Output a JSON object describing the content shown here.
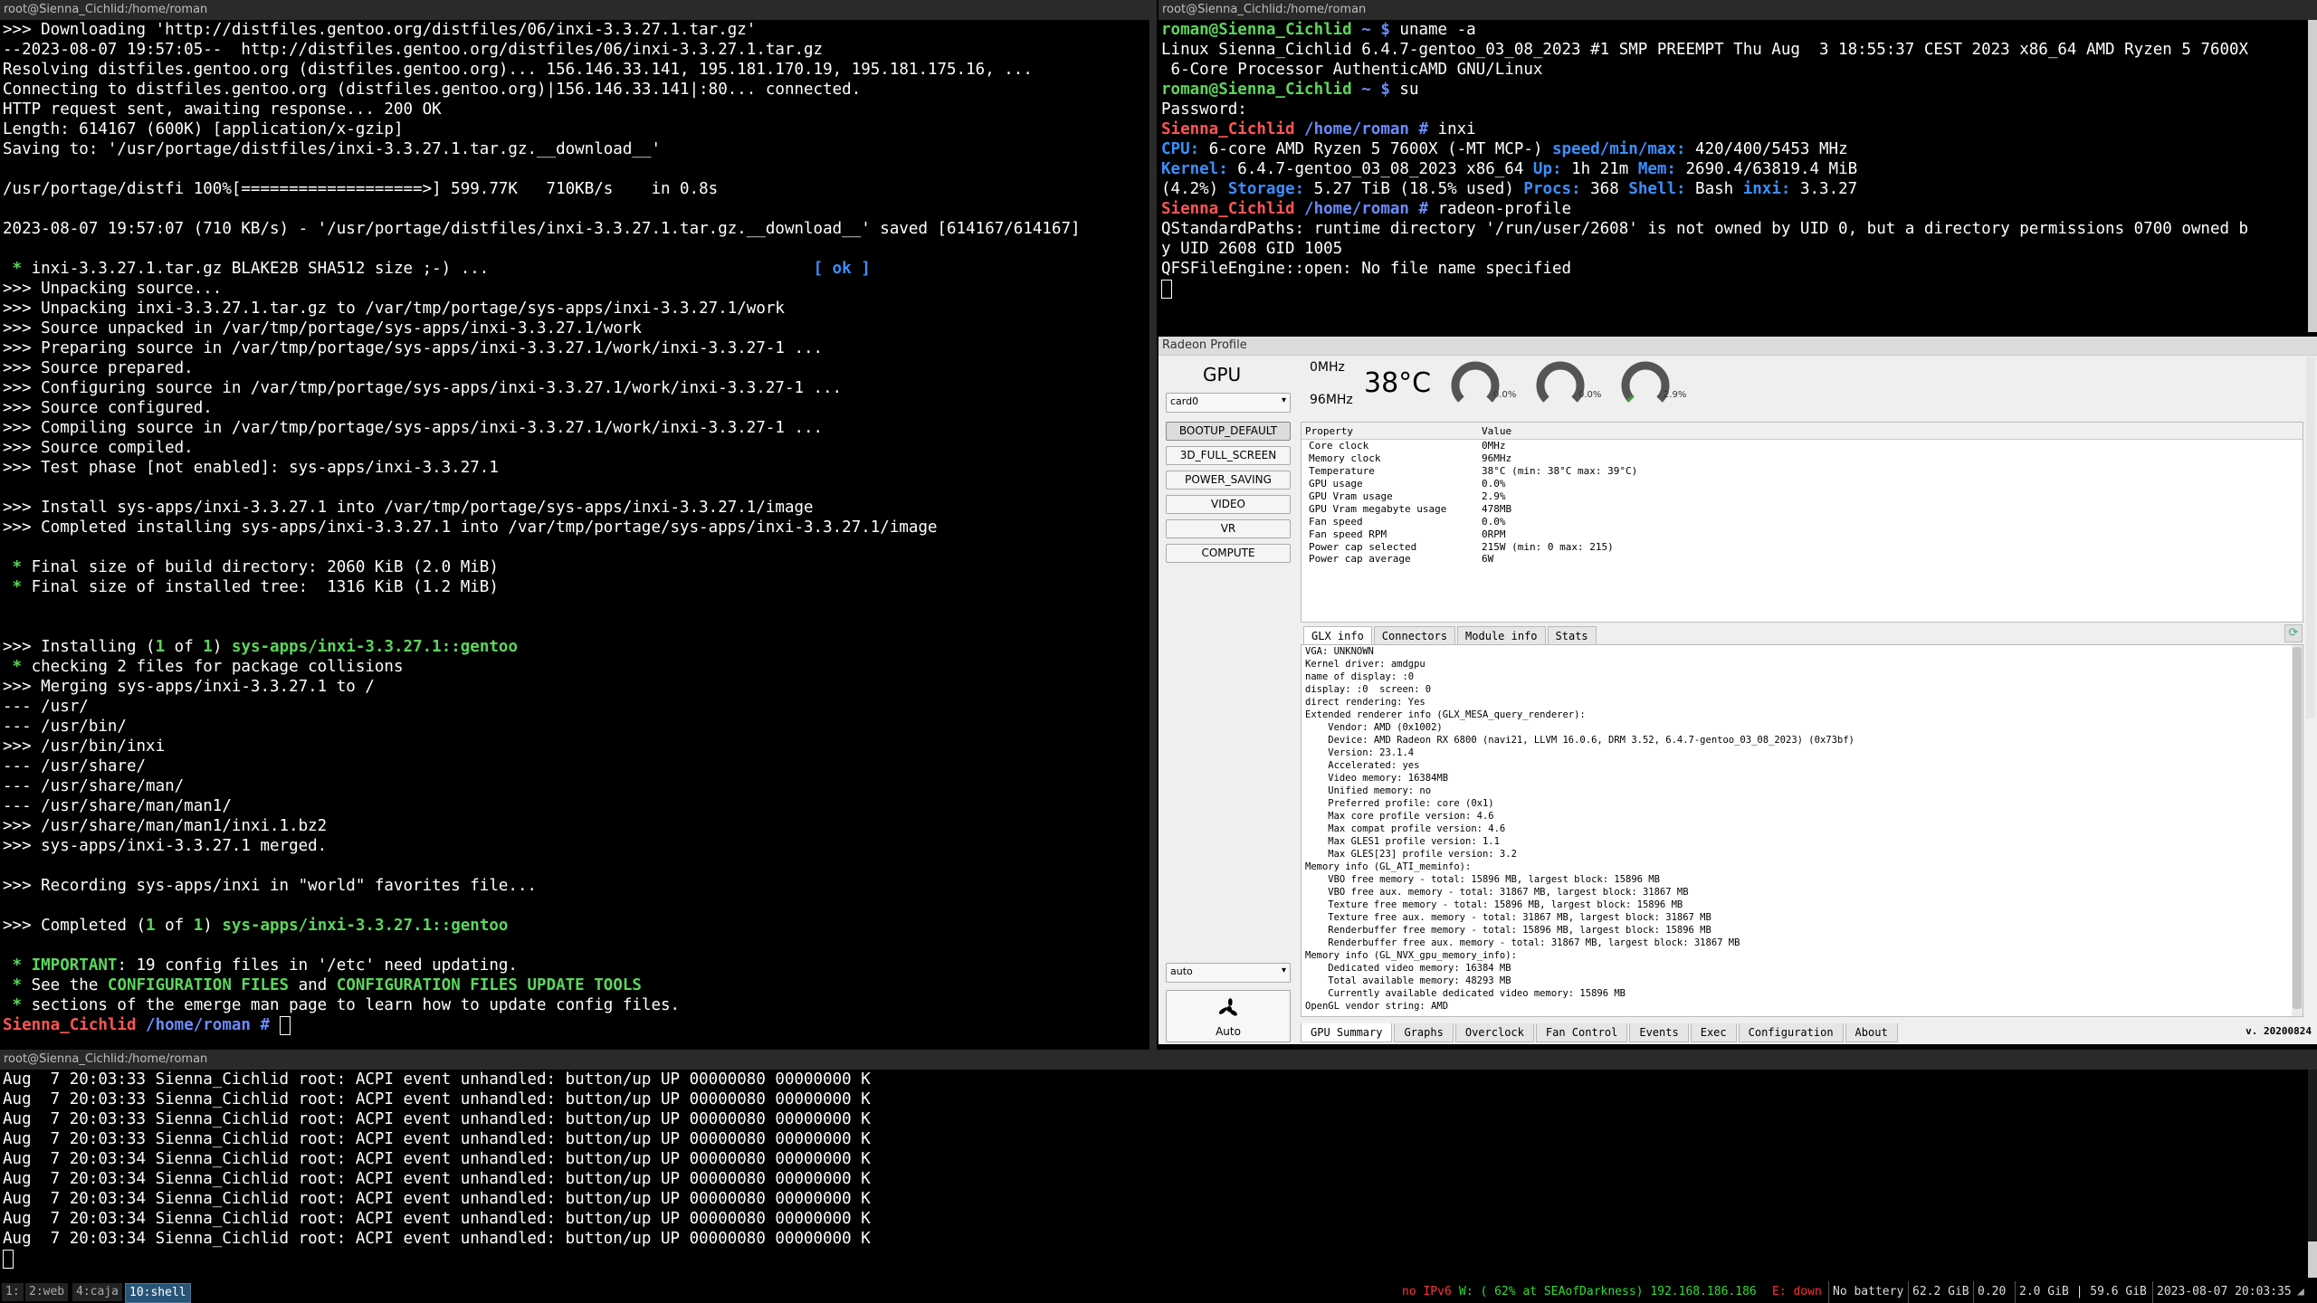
{
  "left_term": {
    "title": "root@Sienna_Cichlid:/home/roman",
    "lines": [
      [
        {
          "t": ">>> Downloading 'http://distfiles.gentoo.org/distfiles/06/inxi-3.3.27.1.tar.gz'"
        }
      ],
      [
        {
          "t": "--2023-08-07 19:57:05--  http://distfiles.gentoo.org/distfiles/06/inxi-3.3.27.1.tar.gz"
        }
      ],
      [
        {
          "t": "Resolving distfiles.gentoo.org (distfiles.gentoo.org)... 156.146.33.141, 195.181.170.19, 195.181.175.16, ..."
        }
      ],
      [
        {
          "t": "Connecting to distfiles.gentoo.org (distfiles.gentoo.org)|156.146.33.141|:80... connected."
        }
      ],
      [
        {
          "t": "HTTP request sent, awaiting response... 200 OK"
        }
      ],
      [
        {
          "t": "Length: 614167 (600K) [application/x-gzip]"
        }
      ],
      [
        {
          "t": "Saving to: '/usr/portage/distfiles/inxi-3.3.27.1.tar.gz.__download__'"
        }
      ],
      [
        {
          "t": ""
        }
      ],
      [
        {
          "t": "/usr/portage/distfi 100%[===================>] 599.77K   710KB/s    in 0.8s"
        }
      ],
      [
        {
          "t": ""
        }
      ],
      [
        {
          "t": "2023-08-07 19:57:07 (710 KB/s) - '/usr/portage/distfiles/inxi-3.3.27.1.tar.gz.__download__' saved [614167/614167]"
        }
      ],
      [
        {
          "t": ""
        }
      ],
      [
        {
          "t": " * ",
          "c": "c-green"
        },
        {
          "t": "inxi-3.3.27.1.tar.gz BLAKE2B SHA512 size ;-) ...                                  "
        },
        {
          "t": "[ ok ]",
          "c": "ok"
        }
      ],
      [
        {
          "t": ">>> Unpacking source..."
        }
      ],
      [
        {
          "t": ">>> Unpacking inxi-3.3.27.1.tar.gz to /var/tmp/portage/sys-apps/inxi-3.3.27.1/work"
        }
      ],
      [
        {
          "t": ">>> Source unpacked in /var/tmp/portage/sys-apps/inxi-3.3.27.1/work"
        }
      ],
      [
        {
          "t": ">>> Preparing source in /var/tmp/portage/sys-apps/inxi-3.3.27.1/work/inxi-3.3.27-1 ..."
        }
      ],
      [
        {
          "t": ">>> Source prepared."
        }
      ],
      [
        {
          "t": ">>> Configuring source in /var/tmp/portage/sys-apps/inxi-3.3.27.1/work/inxi-3.3.27-1 ..."
        }
      ],
      [
        {
          "t": ">>> Source configured."
        }
      ],
      [
        {
          "t": ">>> Compiling source in /var/tmp/portage/sys-apps/inxi-3.3.27.1/work/inxi-3.3.27-1 ..."
        }
      ],
      [
        {
          "t": ">>> Source compiled."
        }
      ],
      [
        {
          "t": ">>> Test phase [not enabled]: sys-apps/inxi-3.3.27.1"
        }
      ],
      [
        {
          "t": ""
        }
      ],
      [
        {
          "t": ">>> Install sys-apps/inxi-3.3.27.1 into /var/tmp/portage/sys-apps/inxi-3.3.27.1/image"
        }
      ],
      [
        {
          "t": ">>> Completed installing sys-apps/inxi-3.3.27.1 into /var/tmp/portage/sys-apps/inxi-3.3.27.1/image"
        }
      ],
      [
        {
          "t": ""
        }
      ],
      [
        {
          "t": " * ",
          "c": "c-green"
        },
        {
          "t": "Final size of build directory: 2060 KiB (2.0 MiB)"
        }
      ],
      [
        {
          "t": " * ",
          "c": "c-green"
        },
        {
          "t": "Final size of installed tree:  1316 KiB (1.2 MiB)"
        }
      ],
      [
        {
          "t": ""
        }
      ],
      [
        {
          "t": ""
        }
      ],
      [
        {
          "t": ">>> Installing ("
        },
        {
          "t": "1",
          "c": "c-green"
        },
        {
          "t": " of "
        },
        {
          "t": "1",
          "c": "c-green"
        },
        {
          "t": ") "
        },
        {
          "t": "sys-apps/inxi-3.3.27.1::gentoo",
          "c": "c-green"
        }
      ],
      [
        {
          "t": " * ",
          "c": "c-green"
        },
        {
          "t": "checking 2 files for package collisions"
        }
      ],
      [
        {
          "t": ">>> Merging sys-apps/inxi-3.3.27.1 to /"
        }
      ],
      [
        {
          "t": "--- /usr/"
        }
      ],
      [
        {
          "t": "--- /usr/bin/"
        }
      ],
      [
        {
          "t": ">>> /usr/bin/inxi"
        }
      ],
      [
        {
          "t": "--- /usr/share/"
        }
      ],
      [
        {
          "t": "--- /usr/share/man/"
        }
      ],
      [
        {
          "t": "--- /usr/share/man/man1/"
        }
      ],
      [
        {
          "t": ">>> /usr/share/man/man1/inxi.1.bz2"
        }
      ],
      [
        {
          "t": ">>> sys-apps/inxi-3.3.27.1 merged."
        }
      ],
      [
        {
          "t": ""
        }
      ],
      [
        {
          "t": ">>> Recording sys-apps/inxi in \"world\" favorites file..."
        }
      ],
      [
        {
          "t": ""
        }
      ],
      [
        {
          "t": ">>> Completed ("
        },
        {
          "t": "1",
          "c": "c-green"
        },
        {
          "t": " of "
        },
        {
          "t": "1",
          "c": "c-green"
        },
        {
          "t": ") "
        },
        {
          "t": "sys-apps/inxi-3.3.27.1::gentoo",
          "c": "c-green"
        }
      ],
      [
        {
          "t": ""
        }
      ],
      [
        {
          "t": " * ",
          "c": "c-green"
        },
        {
          "t": "IMPORTANT",
          "c": "c-green"
        },
        {
          "t": ": 19 config files in '/etc' need updating."
        }
      ],
      [
        {
          "t": " * ",
          "c": "c-green"
        },
        {
          "t": "See the "
        },
        {
          "t": "CONFIGURATION FILES",
          "c": "c-green"
        },
        {
          "t": " and "
        },
        {
          "t": "CONFIGURATION FILES UPDATE TOOLS",
          "c": "c-green"
        }
      ],
      [
        {
          "t": " * ",
          "c": "c-green"
        },
        {
          "t": "sections of the emerge man page to learn how to update config files."
        }
      ],
      [
        {
          "t": "Sienna_Cichlid",
          "c": "c-red"
        },
        {
          "t": " /home/roman #",
          "c": "c-blue"
        },
        {
          "t": " "
        }
      ]
    ]
  },
  "right_term": {
    "title": "root@Sienna_Cichlid:/home/roman",
    "lines": [
      [
        {
          "t": "roman@Sienna_Cichlid",
          "c": "c-green"
        },
        {
          "t": " ~ $ ",
          "c": "c-blue"
        },
        {
          "t": "uname -a"
        }
      ],
      [
        {
          "t": "Linux Sienna_Cichlid 6.4.7-gentoo_03_08_2023 #1 SMP PREEMPT Thu Aug  3 18:55:37 CEST 2023 x86_64 AMD Ryzen 5 7600X"
        }
      ],
      [
        {
          "t": " 6-Core Processor AuthenticAMD GNU/Linux"
        }
      ],
      [
        {
          "t": "roman@Sienna_Cichlid",
          "c": "c-green"
        },
        {
          "t": " ~ $ ",
          "c": "c-blue"
        },
        {
          "t": "su"
        }
      ],
      [
        {
          "t": "Password:"
        }
      ],
      [
        {
          "t": "Sienna_Cichlid",
          "c": "c-red"
        },
        {
          "t": " /home/roman # ",
          "c": "c-blue"
        },
        {
          "t": "inxi"
        }
      ],
      [
        {
          "t": "CPU:",
          "c": "c-cyan"
        },
        {
          "t": " 6-core AMD Ryzen 5 7600X (-MT MCP-) "
        },
        {
          "t": "speed/min/max:",
          "c": "c-cyan"
        },
        {
          "t": " 420/400/5453 MHz"
        }
      ],
      [
        {
          "t": "Kernel:",
          "c": "c-cyan"
        },
        {
          "t": " 6.4.7-gentoo_03_08_2023 x86_64 "
        },
        {
          "t": "Up:",
          "c": "c-cyan"
        },
        {
          "t": " 1h 21m "
        },
        {
          "t": "Mem:",
          "c": "c-cyan"
        },
        {
          "t": " 2690.4/63819.4 MiB"
        }
      ],
      [
        {
          "t": "(4.2%) "
        },
        {
          "t": "Storage:",
          "c": "c-cyan"
        },
        {
          "t": " 5.27 TiB (18.5% used) "
        },
        {
          "t": "Procs:",
          "c": "c-cyan"
        },
        {
          "t": " 368 "
        },
        {
          "t": "Shell:",
          "c": "c-cyan"
        },
        {
          "t": " Bash "
        },
        {
          "t": "inxi:",
          "c": "c-cyan"
        },
        {
          "t": " 3.3.27"
        }
      ],
      [
        {
          "t": "Sienna_Cichlid",
          "c": "c-red"
        },
        {
          "t": " /home/roman # ",
          "c": "c-blue"
        },
        {
          "t": "radeon-profile"
        }
      ],
      [
        {
          "t": "QStandardPaths: runtime directory '/run/user/2608' is not owned by UID 0, but a directory permissions 0700 owned b"
        }
      ],
      [
        {
          "t": "y UID 2608 GID 1005"
        }
      ],
      [
        {
          "t": "QFSFileEngine::open: No file name specified"
        }
      ]
    ]
  },
  "bottom_term": {
    "title": "root@Sienna_Cichlid:/home/roman",
    "lines": [
      "Aug  7 20:03:33 Sienna_Cichlid root: ACPI event unhandled: button/up UP 00000080 00000000 K",
      "Aug  7 20:03:33 Sienna_Cichlid root: ACPI event unhandled: button/up UP 00000080 00000000 K",
      "Aug  7 20:03:33 Sienna_Cichlid root: ACPI event unhandled: button/up UP 00000080 00000000 K",
      "Aug  7 20:03:33 Sienna_Cichlid root: ACPI event unhandled: button/up UP 00000080 00000000 K",
      "Aug  7 20:03:34 Sienna_Cichlid root: ACPI event unhandled: button/up UP 00000080 00000000 K",
      "Aug  7 20:03:34 Sienna_Cichlid root: ACPI event unhandled: button/up UP 00000080 00000000 K",
      "Aug  7 20:03:34 Sienna_Cichlid root: ACPI event unhandled: button/up UP 00000080 00000000 K",
      "Aug  7 20:03:34 Sienna_Cichlid root: ACPI event unhandled: button/up UP 00000080 00000000 K",
      "Aug  7 20:03:34 Sienna_Cichlid root: ACPI event unhandled: button/up UP 00000080 00000000 K"
    ]
  },
  "radeon": {
    "title": "Radeon Profile",
    "gpu_label": "GPU",
    "card_select": "card0",
    "core_mhz": "0MHz",
    "mem_mhz": "96MHz",
    "temp": "38°C",
    "gauges": [
      {
        "pct": "0.0%",
        "value": 0.0
      },
      {
        "pct": "0.0%",
        "value": 0.0
      },
      {
        "pct": "2.9%",
        "value": 0.029
      }
    ],
    "profiles": [
      "BOOTUP_DEFAULT",
      "3D_FULL_SCREEN",
      "POWER_SAVING",
      "VIDEO",
      "VR",
      "COMPUTE"
    ],
    "fan_mode_select": "auto",
    "fan_label": "Auto",
    "props_header": [
      "Property",
      "Value"
    ],
    "props": [
      [
        "Core clock",
        "0MHz"
      ],
      [
        "Memory clock",
        "96MHz"
      ],
      [
        "Temperature",
        "38°C (min: 38°C max: 39°C)"
      ],
      [
        "GPU usage",
        "0.0%"
      ],
      [
        "GPU Vram usage",
        "2.9%"
      ],
      [
        "GPU Vram megabyte usage",
        "478MB"
      ],
      [
        "Fan speed",
        "0.0%"
      ],
      [
        "Fan speed RPM",
        "0RPM"
      ],
      [
        "Power cap selected",
        "215W (min: 0 max: 215)"
      ],
      [
        "Power cap average",
        "6W"
      ]
    ],
    "info_tabs": [
      "GLX info",
      "Connectors",
      "Module info",
      "Stats"
    ],
    "glx_lines": [
      "VGA: UNKNOWN",
      "Kernel driver: amdgpu",
      "name of display: :0",
      "display: :0  screen: 0",
      "direct rendering: Yes",
      "Extended renderer info (GLX_MESA_query_renderer):",
      "    Vendor: AMD (0x1002)",
      "    Device: AMD Radeon RX 6800 (navi21, LLVM 16.0.6, DRM 3.52, 6.4.7-gentoo_03_08_2023) (0x73bf)",
      "    Version: 23.1.4",
      "    Accelerated: yes",
      "    Video memory: 16384MB",
      "    Unified memory: no",
      "    Preferred profile: core (0x1)",
      "    Max core profile version: 4.6",
      "    Max compat profile version: 4.6",
      "    Max GLES1 profile version: 1.1",
      "    Max GLES[23] profile version: 3.2",
      "Memory info (GL_ATI_meminfo):",
      "    VBO free memory - total: 15896 MB, largest block: 15896 MB",
      "    VBO free aux. memory - total: 31867 MB, largest block: 31867 MB",
      "    Texture free memory - total: 15896 MB, largest block: 15896 MB",
      "    Texture free aux. memory - total: 31867 MB, largest block: 31867 MB",
      "    Renderbuffer free memory - total: 15896 MB, largest block: 15896 MB",
      "    Renderbuffer free aux. memory - total: 31867 MB, largest block: 31867 MB",
      "Memory info (GL_NVX_gpu_memory_info):",
      "    Dedicated video memory: 16384 MB",
      "    Total available memory: 48293 MB",
      "    Currently available dedicated video memory: 15896 MB",
      "OpenGL vendor string: AMD"
    ],
    "bottom_tabs": [
      "GPU Summary",
      "Graphs",
      "Overclock",
      "Fan Control",
      "Events",
      "Exec",
      "Configuration",
      "About"
    ],
    "version": "v. 20200824"
  },
  "statusbar": {
    "workspaces": [
      "1:",
      "2:web",
      "4:caja",
      "10:shell"
    ],
    "ipv6": "no IPv6",
    "wifi": "W: ( 62% at SEAofDarkness) 192.168.186.186",
    "eth": "E: down",
    "battery": "No battery",
    "disk": "62.2 GiB",
    "load": "0.20",
    "mem": "2.0 GiB | 59.6 GiB",
    "datetime": "2023-08-07 20:03:35",
    "colors": {
      "bad": "#ff3333",
      "good": "#33dd33",
      "focus_bg": "#285577"
    }
  }
}
